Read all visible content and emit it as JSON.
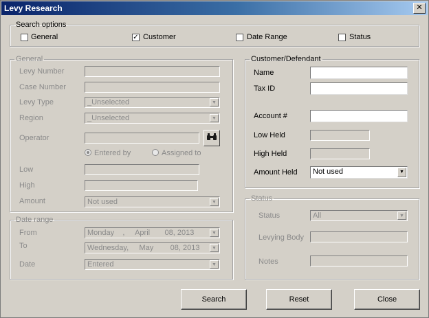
{
  "window": {
    "title": "Levy Research",
    "close_glyph": "✕"
  },
  "search_options": {
    "legend": "Search options",
    "general": {
      "label": "General",
      "checked": false
    },
    "customer": {
      "label": "Customer",
      "checked": true
    },
    "date_range": {
      "label": "Date Range",
      "checked": false
    },
    "status": {
      "label": "Status",
      "checked": false
    }
  },
  "general": {
    "legend": "General",
    "levy_number": {
      "label": "Levy Number",
      "value": ""
    },
    "case_number": {
      "label": "Case Number",
      "value": ""
    },
    "levy_type": {
      "label": "Levy Type",
      "value": "_Unselected"
    },
    "region": {
      "label": "Region",
      "value": "_Unselected"
    },
    "operator": {
      "label": "Operator",
      "value": ""
    },
    "entered_by": "Entered by",
    "assigned_to": "Assigned to",
    "low": {
      "label": "Low",
      "value": ""
    },
    "high": {
      "label": "High",
      "value": ""
    },
    "amount": {
      "label": "Amount",
      "value": "Not used"
    }
  },
  "date_range": {
    "legend": "Date range",
    "from": {
      "label": "From",
      "value": "Monday    ,     April       08, 2013"
    },
    "to": {
      "label": "To",
      "value": "Wednesday,     May        08, 2013"
    },
    "date": {
      "label": "Date",
      "value": "Entered"
    }
  },
  "customer": {
    "legend": "Customer/Defendant",
    "name": {
      "label": "Name",
      "value": ""
    },
    "tax_id": {
      "label": "Tax ID",
      "value": ""
    },
    "account": {
      "label": "Account #",
      "value": ""
    },
    "low_held": {
      "label": "Low Held",
      "value": ""
    },
    "high_held": {
      "label": "High Held",
      "value": ""
    },
    "amount_held": {
      "label": "Amount Held",
      "value": "Not used"
    }
  },
  "status": {
    "legend": "Status",
    "status": {
      "label": "Status",
      "value": "All"
    },
    "levying_body": {
      "label": "Levying Body",
      "value": ""
    },
    "notes": {
      "label": "Notes",
      "value": ""
    }
  },
  "buttons": {
    "search": "Search",
    "reset": "Reset",
    "close": "Close"
  },
  "icons": {
    "operator_lookup": "binoculars-icon",
    "dropdown": "chevron-down-icon"
  }
}
